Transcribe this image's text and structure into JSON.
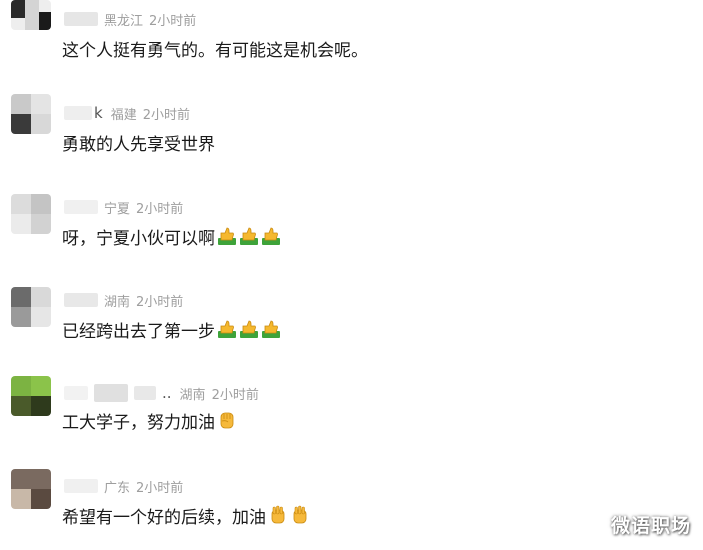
{
  "comments": [
    {
      "location": "黑龙江",
      "time": "2小时前",
      "text": "这个人挺有勇气的。有可能这是机会呢。"
    },
    {
      "nick_visible": "k",
      "location": "福建",
      "time": "2小时前",
      "text": "勇敢的人先享受世界"
    },
    {
      "location": "宁夏",
      "time": "2小时前",
      "text": "呀，宁夏小伙可以啊",
      "emojis": [
        "thumbs-up-icon",
        "thumbs-up-icon",
        "thumbs-up-icon"
      ]
    },
    {
      "location": "湖南",
      "time": "2小时前",
      "text": "已经跨出去了第一步",
      "emojis": [
        "thumbs-up-icon",
        "thumbs-up-icon",
        "thumbs-up-icon"
      ]
    },
    {
      "nick_visible": "..",
      "location": "湖南",
      "time": "2小时前",
      "text": "工大学子，努力加油",
      "emojis": [
        "raised-fist-icon"
      ]
    },
    {
      "location": "广东",
      "time": "2小时前",
      "text": "希望有一个好的后续，加油",
      "emojis": [
        "raised-hand-icon",
        "raised-hand-icon"
      ]
    }
  ],
  "watermark": "微语职场"
}
